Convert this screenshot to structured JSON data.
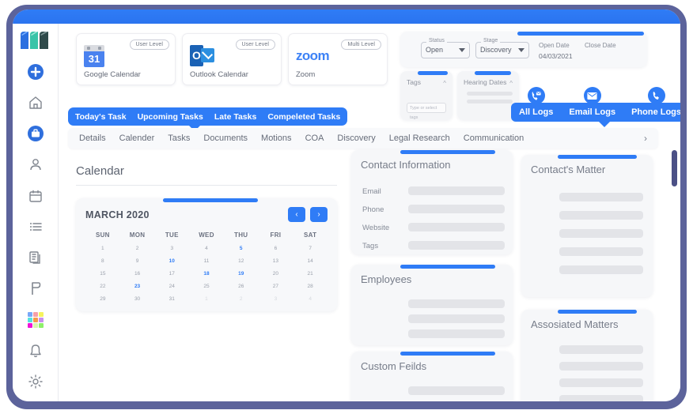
{
  "theme": {
    "accent": "#2f7cf6",
    "frame": "#5c639b",
    "panel_bg": "#f6f7f9",
    "skeleton": "#e3e4e8"
  },
  "sidebar": {
    "logo_name": "app-logo",
    "items": [
      {
        "icon": "plus-circle-icon",
        "name": "add"
      },
      {
        "icon": "home-icon",
        "name": "home"
      },
      {
        "icon": "briefcase-icon",
        "name": "matters"
      },
      {
        "icon": "person-icon",
        "name": "contacts"
      },
      {
        "icon": "calendar-icon",
        "name": "calendar"
      },
      {
        "icon": "list-icon",
        "name": "tasks"
      },
      {
        "icon": "document-icon",
        "name": "documents"
      },
      {
        "icon": "flag-icon",
        "name": "flags"
      },
      {
        "icon": "grid-apps-icon",
        "name": "apps"
      },
      {
        "icon": "bell-icon",
        "name": "notifications"
      },
      {
        "icon": "gear-icon",
        "name": "settings"
      }
    ]
  },
  "integrations": [
    {
      "name": "Google Calendar",
      "level": "User Level",
      "icon": "google-calendar-icon"
    },
    {
      "name": "Outlook Calendar",
      "level": "User Level",
      "icon": "outlook-icon"
    },
    {
      "name": "Zoom",
      "level": "Multi Level",
      "icon": "zoom-icon"
    }
  ],
  "status_panel": {
    "status_label": "Status",
    "status_value": "Open",
    "stage_label": "Stage",
    "stage_value": "Discovery",
    "open_date_label": "Open Date",
    "open_date_value": "04/03/2021",
    "close_date_label": "Close Date",
    "close_date_value": ""
  },
  "mini_panels": {
    "tags": {
      "title": "Tags",
      "input_placeholder": "Type or select tags"
    },
    "hearing_dates": {
      "title": "Hearing Dates"
    }
  },
  "logs": [
    {
      "label": "All Logs",
      "icon": "phone-message-icon"
    },
    {
      "label": "Email Logs",
      "icon": "envelope-icon"
    },
    {
      "label": "Phone Logs",
      "icon": "phone-icon"
    }
  ],
  "task_tabs": [
    "Today's Task",
    "Upcoming Tasks",
    "Late Tasks",
    "Compeleted Tasks"
  ],
  "nav_tabs": [
    "Details",
    "Calender",
    "Tasks",
    "Documents",
    "Motions",
    "COA",
    "Discovery",
    "Legal Research",
    "Communication"
  ],
  "nav_next_glyph": "›",
  "calendar": {
    "heading": "Calendar",
    "month_year": "MARCH 2020",
    "prev_glyph": "‹",
    "next_glyph": "›",
    "day_names": [
      "SUN",
      "MON",
      "TUE",
      "WED",
      "THU",
      "FRI",
      "SAT"
    ],
    "weeks": [
      [
        {
          "d": "1"
        },
        {
          "d": "2"
        },
        {
          "d": "3"
        },
        {
          "d": "4"
        },
        {
          "d": "5",
          "hl": true
        },
        {
          "d": "6"
        },
        {
          "d": "7"
        }
      ],
      [
        {
          "d": "8"
        },
        {
          "d": "9"
        },
        {
          "d": "10",
          "hl": true
        },
        {
          "d": "11"
        },
        {
          "d": "12"
        },
        {
          "d": "13"
        },
        {
          "d": "14"
        }
      ],
      [
        {
          "d": "15"
        },
        {
          "d": "16"
        },
        {
          "d": "17"
        },
        {
          "d": "18",
          "hl": true
        },
        {
          "d": "19",
          "hl": true
        },
        {
          "d": "20"
        },
        {
          "d": "21"
        }
      ],
      [
        {
          "d": "22"
        },
        {
          "d": "23",
          "hl": true
        },
        {
          "d": "24"
        },
        {
          "d": "25"
        },
        {
          "d": "26"
        },
        {
          "d": "27"
        },
        {
          "d": "28"
        }
      ],
      [
        {
          "d": "29"
        },
        {
          "d": "30"
        },
        {
          "d": "31"
        },
        {
          "d": "1",
          "out": true
        },
        {
          "d": "2",
          "out": true
        },
        {
          "d": "3",
          "out": true
        },
        {
          "d": "4",
          "out": true
        }
      ]
    ]
  },
  "contact_information": {
    "title": "Contact Information",
    "fields": [
      "Email",
      "Phone",
      "Website",
      "Tags"
    ]
  },
  "employees": {
    "title": "Employees",
    "row_count": 3
  },
  "custom_fields": {
    "title": "Custom Feilds",
    "row_count": 1
  },
  "contacts_matter": {
    "title": "Contact's Matter",
    "row_count": 5
  },
  "associated_matters": {
    "title": "Assosiated Matters",
    "row_count": 4
  }
}
